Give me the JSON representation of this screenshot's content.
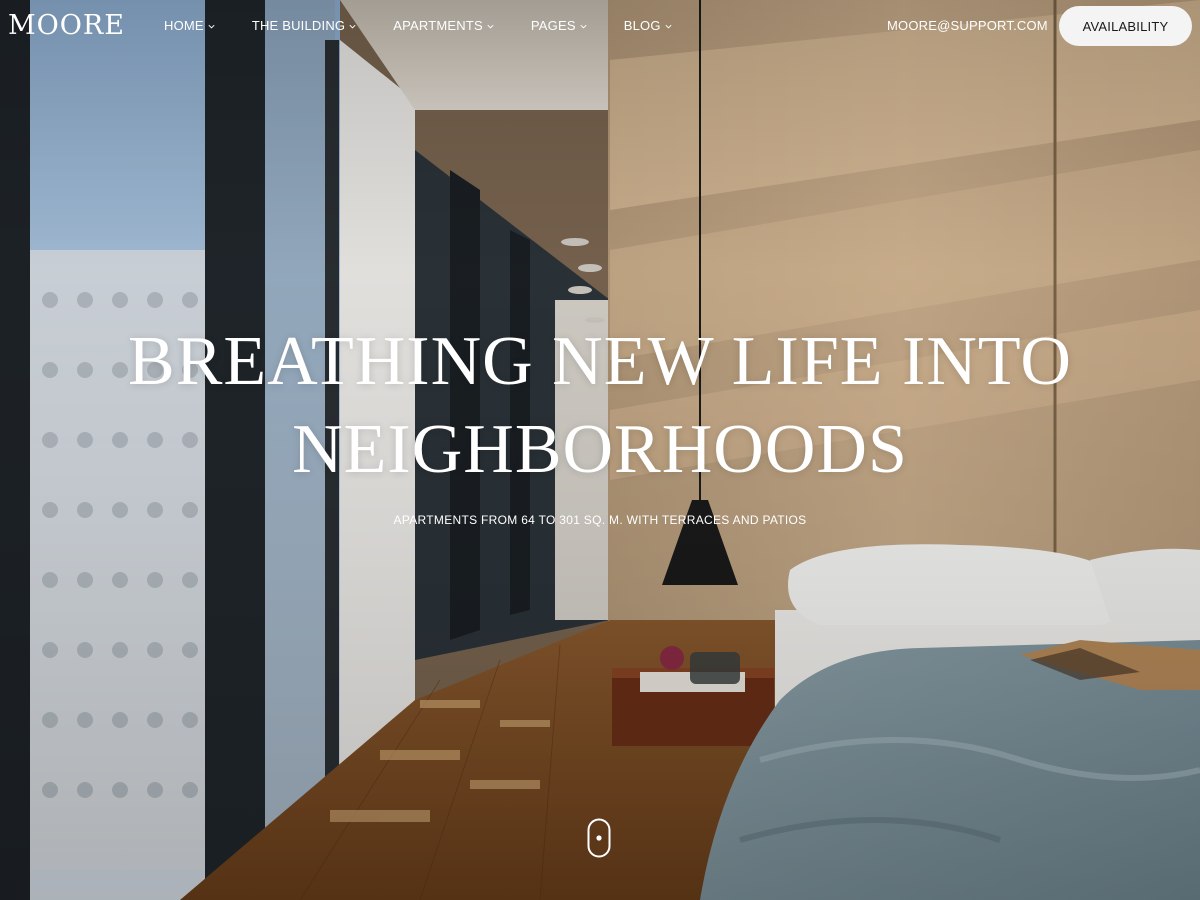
{
  "header": {
    "logo": "MOORE",
    "nav": [
      {
        "label": "HOME",
        "has_dropdown": true
      },
      {
        "label": "THE BUILDING",
        "has_dropdown": true
      },
      {
        "label": "APARTMENTS",
        "has_dropdown": true
      },
      {
        "label": "PAGES",
        "has_dropdown": true
      },
      {
        "label": "BLOG",
        "has_dropdown": true
      }
    ],
    "email": "MOORE@SUPPORT.COM",
    "cta_label": "AVAILABILITY"
  },
  "hero": {
    "headline_line1": "BREATHING NEW LIFE INTO",
    "headline_line2": "NEIGHBORHOODS",
    "subline": "APARTMENTS FROM 64 TO 301 SQ. M. WITH TERRACES AND PATIOS",
    "scroll_icon": "mouse-scroll-icon",
    "background_image": "apartment-interior-photo"
  },
  "colors": {
    "cta_bg": "#f4f4f4",
    "cta_text": "#1a1a1a",
    "text": "#ffffff"
  }
}
